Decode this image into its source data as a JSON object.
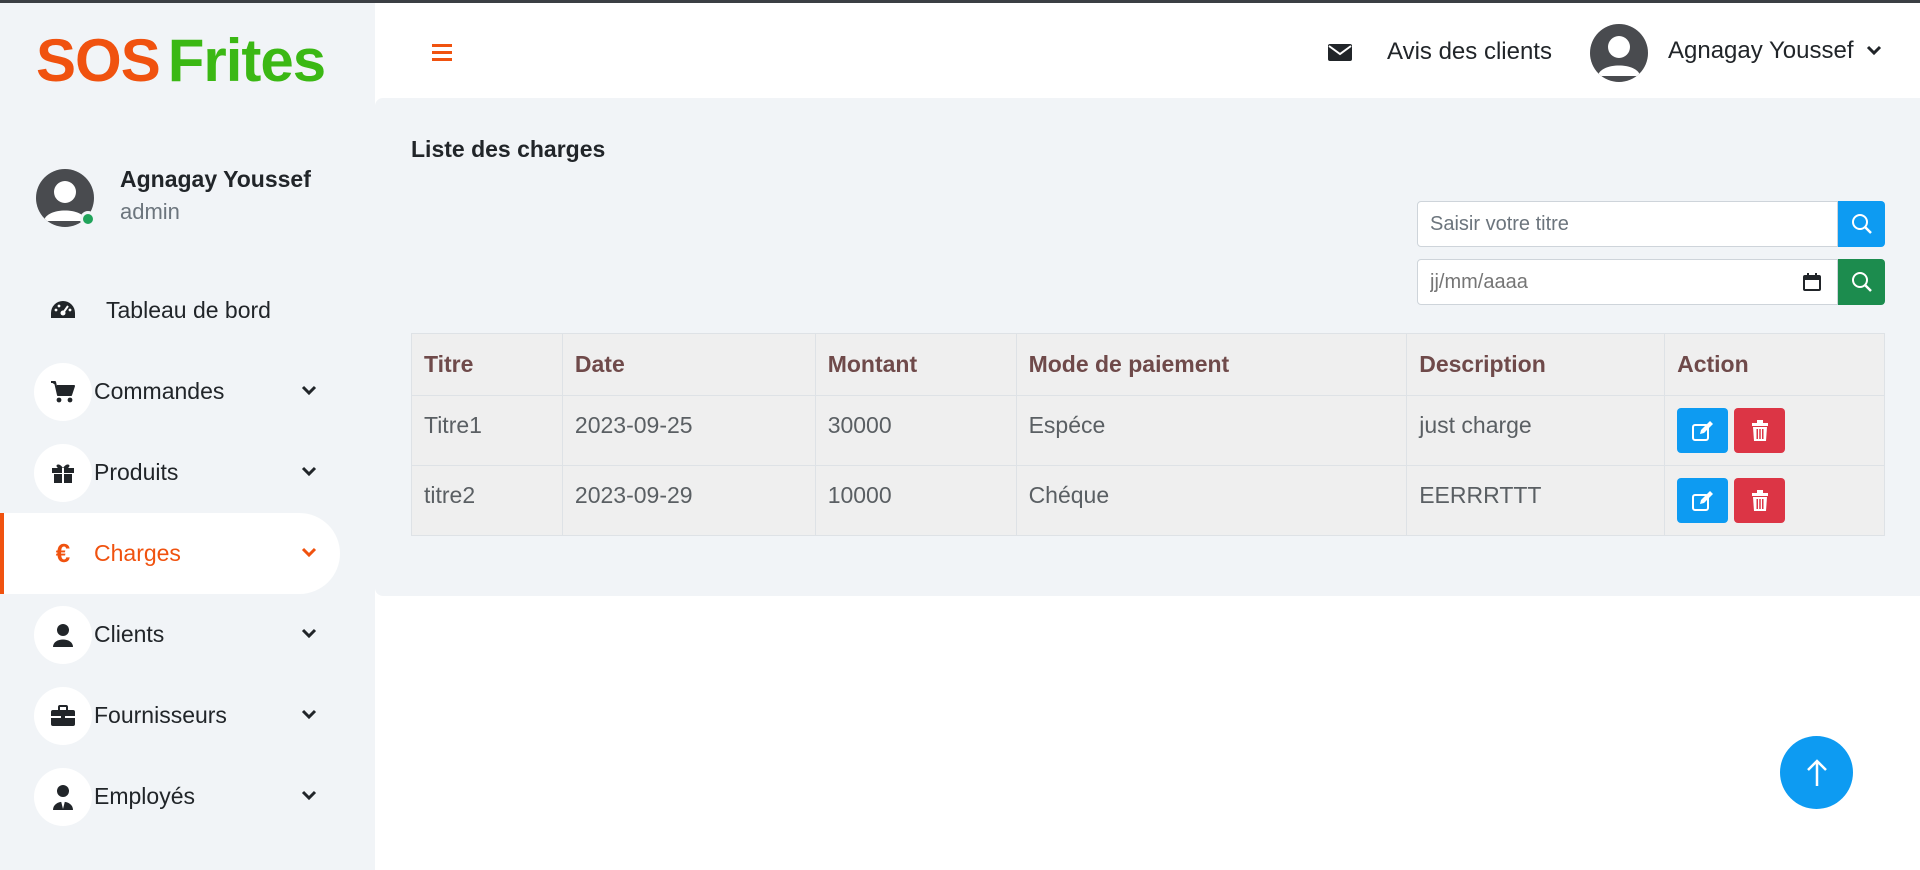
{
  "brand": {
    "part1": "SOS",
    "part2": "Frites"
  },
  "profile": {
    "name": "Agnagay Youssef",
    "role": "admin"
  },
  "sidebar": {
    "items": [
      {
        "label": "Tableau de bord",
        "icon": "gauge-icon"
      },
      {
        "label": "Commandes",
        "icon": "cart-icon"
      },
      {
        "label": "Produits",
        "icon": "gift-icon"
      },
      {
        "label": "Charges",
        "icon": "euro-icon",
        "active": true
      },
      {
        "label": "Clients",
        "icon": "person-icon"
      },
      {
        "label": "Fournisseurs",
        "icon": "briefcase-icon"
      },
      {
        "label": "Employés",
        "icon": "employee-icon"
      }
    ]
  },
  "header": {
    "reviews_label": "Avis des clients",
    "user_name": "Agnagay Youssef"
  },
  "page": {
    "title": "Liste des charges",
    "search": {
      "placeholder": "Saisir votre titre"
    },
    "date_filter": {
      "placeholder": "jj/mm/aaaa"
    }
  },
  "table": {
    "headers": [
      "Titre",
      "Date",
      "Montant",
      "Mode de paiement",
      "Description",
      "Action"
    ],
    "rows": [
      {
        "titre": "Titre1",
        "date": "2023-09-25",
        "montant": "30000",
        "mode": "Espéce",
        "description": "just charge"
      },
      {
        "titre": "titre2",
        "date": "2023-09-29",
        "montant": "10000",
        "mode": "Chéque",
        "description": "EERRRTTT"
      }
    ]
  },
  "colors": {
    "accent": "#f0520f",
    "brand_green": "#3bb814",
    "primary": "#0d9bf2",
    "success": "#1c8c4e",
    "danger": "#dc3545"
  }
}
